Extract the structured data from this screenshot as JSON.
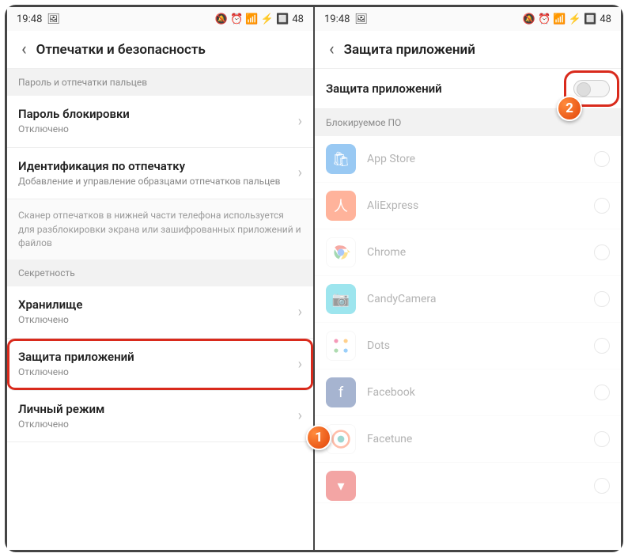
{
  "status": {
    "time": "19:48",
    "battery": "48",
    "icons_left": "🖼",
    "icons_right": "🔕 ⏰ 📶 ⚡ 🔲"
  },
  "left": {
    "header": "Отпечатки и безопасность",
    "section1": "Пароль и отпечатки пальцев",
    "row1": {
      "title": "Пароль блокировки",
      "sub": "Отключено"
    },
    "row2": {
      "title": "Идентификация по отпечатку",
      "sub": "Добавление и управление образцами отпечатков пальцев"
    },
    "note": "Сканер отпечатков в нижней части телефона используется для разблокировки экрана или зашифрованных приложений и файлов",
    "section2": "Секретность",
    "row3": {
      "title": "Хранилище",
      "sub": "Отключено"
    },
    "row4": {
      "title": "Защита приложений",
      "sub": "Отключено"
    },
    "row5": {
      "title": "Личный режим",
      "sub": "Отключено"
    }
  },
  "right": {
    "header": "Защита приложений",
    "toggle_label": "Защита приложений",
    "section": "Блокируемое ПО",
    "apps": {
      "a0": "App Store",
      "a1": "AliExpress",
      "a2": "Chrome",
      "a3": "CandyCamera",
      "a4": "Dots",
      "a5": "Facebook",
      "a6": "Facetune"
    }
  },
  "badges": {
    "b1": "1",
    "b2": "2"
  }
}
